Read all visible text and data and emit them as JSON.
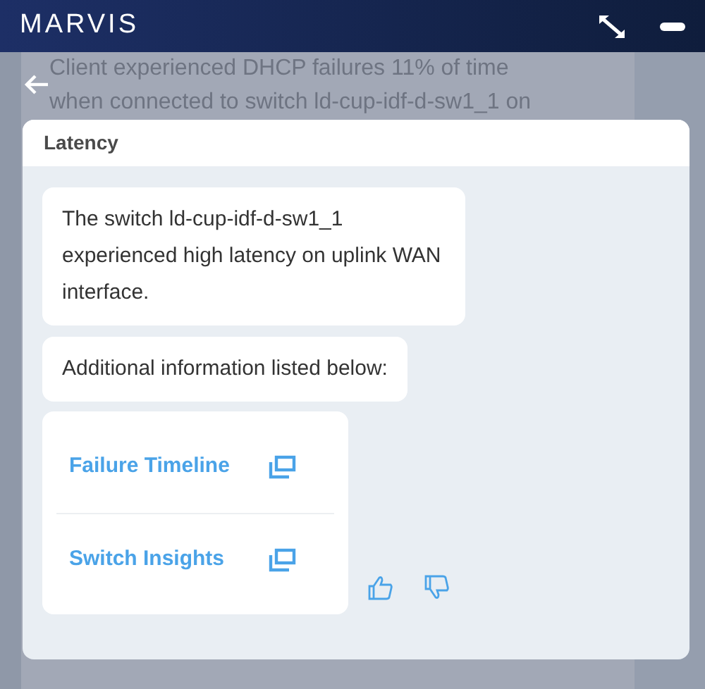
{
  "header": {
    "title": "MARVIS"
  },
  "background_messages": [
    {
      "text": "Client experienced DHCP failures 11% of time when connected to switch ld-cup-idf-d-sw1_1 on"
    }
  ],
  "dialog": {
    "title": "Latency",
    "messages": [
      {
        "text": "The switch ld-cup-idf-d-sw1_1 experienced high latency on uplink WAN interface."
      },
      {
        "text": "Additional information listed below:"
      }
    ],
    "links": [
      {
        "label": "Failure Timeline"
      },
      {
        "label": "Switch Insights"
      }
    ]
  }
}
